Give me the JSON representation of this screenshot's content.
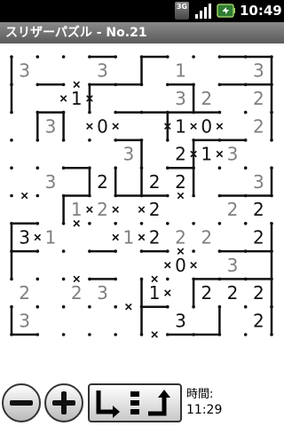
{
  "status_bar": {
    "network_label": "3G",
    "time": "10:49",
    "icons": [
      "network-3g-icon",
      "signal-bars-icon",
      "battery-icon"
    ]
  },
  "title_bar": {
    "title": "スリザーパズル - No.21"
  },
  "puzzle": {
    "rows": 10,
    "cols": 10,
    "clues": [
      {
        "r": 0,
        "c": 0,
        "v": "3",
        "given": true
      },
      {
        "r": 0,
        "c": 3,
        "v": "3",
        "given": true
      },
      {
        "r": 0,
        "c": 6,
        "v": "1",
        "given": true
      },
      {
        "r": 0,
        "c": 9,
        "v": "3",
        "given": true
      },
      {
        "r": 1,
        "c": 2,
        "v": "1",
        "given": false
      },
      {
        "r": 1,
        "c": 6,
        "v": "3",
        "given": true
      },
      {
        "r": 1,
        "c": 7,
        "v": "2",
        "given": true
      },
      {
        "r": 1,
        "c": 9,
        "v": "2",
        "given": true
      },
      {
        "r": 2,
        "c": 1,
        "v": "3",
        "given": true
      },
      {
        "r": 2,
        "c": 3,
        "v": "0",
        "given": false
      },
      {
        "r": 2,
        "c": 6,
        "v": "1",
        "given": false
      },
      {
        "r": 2,
        "c": 7,
        "v": "0",
        "given": false
      },
      {
        "r": 2,
        "c": 9,
        "v": "2",
        "given": true
      },
      {
        "r": 3,
        "c": 4,
        "v": "3",
        "given": true
      },
      {
        "r": 3,
        "c": 6,
        "v": "2",
        "given": false
      },
      {
        "r": 3,
        "c": 7,
        "v": "1",
        "given": false
      },
      {
        "r": 3,
        "c": 8,
        "v": "3",
        "given": true
      },
      {
        "r": 4,
        "c": 1,
        "v": "3",
        "given": true
      },
      {
        "r": 4,
        "c": 3,
        "v": "2",
        "given": false
      },
      {
        "r": 4,
        "c": 5,
        "v": "2",
        "given": false
      },
      {
        "r": 4,
        "c": 6,
        "v": "2",
        "given": false
      },
      {
        "r": 4,
        "c": 9,
        "v": "3",
        "given": true
      },
      {
        "r": 5,
        "c": 2,
        "v": "1",
        "given": true
      },
      {
        "r": 5,
        "c": 3,
        "v": "2",
        "given": true
      },
      {
        "r": 5,
        "c": 5,
        "v": "2",
        "given": false
      },
      {
        "r": 5,
        "c": 8,
        "v": "2",
        "given": true
      },
      {
        "r": 5,
        "c": 9,
        "v": "2",
        "given": false
      },
      {
        "r": 6,
        "c": 0,
        "v": "3",
        "given": false
      },
      {
        "r": 6,
        "c": 1,
        "v": "1",
        "given": true
      },
      {
        "r": 6,
        "c": 4,
        "v": "1",
        "given": true
      },
      {
        "r": 6,
        "c": 5,
        "v": "2",
        "given": false
      },
      {
        "r": 6,
        "c": 6,
        "v": "2",
        "given": true
      },
      {
        "r": 6,
        "c": 7,
        "v": "2",
        "given": true
      },
      {
        "r": 6,
        "c": 9,
        "v": "2",
        "given": false
      },
      {
        "r": 7,
        "c": 6,
        "v": "0",
        "given": false
      },
      {
        "r": 7,
        "c": 8,
        "v": "3",
        "given": true
      },
      {
        "r": 8,
        "c": 0,
        "v": "2",
        "given": true
      },
      {
        "r": 8,
        "c": 2,
        "v": "2",
        "given": true
      },
      {
        "r": 8,
        "c": 3,
        "v": "3",
        "given": true
      },
      {
        "r": 8,
        "c": 5,
        "v": "1",
        "given": false
      },
      {
        "r": 8,
        "c": 7,
        "v": "2",
        "given": false
      },
      {
        "r": 8,
        "c": 8,
        "v": "2",
        "given": false
      },
      {
        "r": 8,
        "c": 9,
        "v": "2",
        "given": false
      },
      {
        "r": 9,
        "c": 0,
        "v": "3",
        "given": true
      },
      {
        "r": 9,
        "c": 6,
        "v": "3",
        "given": false
      },
      {
        "r": 9,
        "c": 9,
        "v": "2",
        "given": false
      }
    ],
    "hlines": [
      [
        0,
        3
      ],
      [
        0,
        5
      ],
      [
        0,
        8
      ],
      [
        0,
        9
      ],
      [
        1,
        1
      ],
      [
        1,
        3
      ],
      [
        1,
        4
      ],
      [
        1,
        6
      ],
      [
        1,
        8
      ],
      [
        1,
        9
      ],
      [
        2,
        1
      ],
      [
        2,
        4
      ],
      [
        2,
        5
      ],
      [
        2,
        6
      ],
      [
        2,
        7
      ],
      [
        3,
        4
      ],
      [
        3,
        7
      ],
      [
        3,
        8
      ],
      [
        4,
        2
      ],
      [
        4,
        6
      ],
      [
        5,
        2
      ],
      [
        5,
        4
      ],
      [
        5,
        5
      ],
      [
        5,
        8
      ],
      [
        5,
        9
      ],
      [
        6,
        0
      ],
      [
        7,
        0
      ],
      [
        7,
        3
      ],
      [
        7,
        5
      ],
      [
        7,
        8
      ],
      [
        7,
        9
      ],
      [
        8,
        3
      ],
      [
        8,
        7
      ],
      [
        8,
        8
      ],
      [
        8,
        9
      ],
      [
        9,
        5
      ],
      [
        10,
        0
      ],
      [
        10,
        6
      ],
      [
        10,
        7
      ]
    ],
    "vlines": [
      [
        0,
        0
      ],
      [
        0,
        5
      ],
      [
        0,
        10
      ],
      [
        1,
        0
      ],
      [
        1,
        3
      ],
      [
        1,
        7
      ],
      [
        1,
        10
      ],
      [
        2,
        1
      ],
      [
        2,
        2
      ],
      [
        2,
        6
      ],
      [
        2,
        10
      ],
      [
        3,
        5
      ],
      [
        3,
        7
      ],
      [
        4,
        3
      ],
      [
        4,
        4
      ],
      [
        4,
        5
      ],
      [
        4,
        7
      ],
      [
        4,
        10
      ],
      [
        5,
        2
      ],
      [
        6,
        0
      ],
      [
        6,
        10
      ],
      [
        7,
        0
      ],
      [
        7,
        10
      ],
      [
        8,
        5
      ],
      [
        8,
        7
      ],
      [
        8,
        10
      ],
      [
        9,
        0
      ],
      [
        9,
        5
      ],
      [
        9,
        8
      ],
      [
        9,
        10
      ]
    ],
    "hcross": [
      [
        1,
        2
      ],
      [
        5,
        0
      ],
      [
        5,
        6
      ],
      [
        6,
        2
      ],
      [
        7,
        6
      ],
      [
        8,
        2
      ],
      [
        8,
        5
      ],
      [
        9,
        4
      ],
      [
        10,
        5
      ]
    ],
    "vcross": [
      [
        1,
        2
      ],
      [
        1,
        3
      ],
      [
        2,
        3
      ],
      [
        2,
        4
      ],
      [
        2,
        6
      ],
      [
        2,
        7
      ],
      [
        2,
        8
      ],
      [
        3,
        7
      ],
      [
        3,
        8
      ],
      [
        5,
        3
      ],
      [
        5,
        4
      ],
      [
        5,
        5
      ],
      [
        6,
        1
      ],
      [
        6,
        4
      ],
      [
        6,
        5
      ],
      [
        7,
        6
      ],
      [
        7,
        7
      ],
      [
        8,
        6
      ]
    ]
  },
  "toolbar": {
    "zoom_out_icon": "minus-icon",
    "zoom_in_icon": "plus-icon",
    "mode_icons": [
      "corner-arrow-icon",
      "list-icon",
      "up-turn-arrow-icon"
    ],
    "timer_label": "時間:",
    "timer_value": "11:29"
  },
  "colors": {
    "line": "#111111",
    "given_clue": "#808080",
    "entered_clue": "#111111",
    "title_bar_top": "#8a8a8a",
    "title_bar_bottom": "#5a5a5a"
  }
}
